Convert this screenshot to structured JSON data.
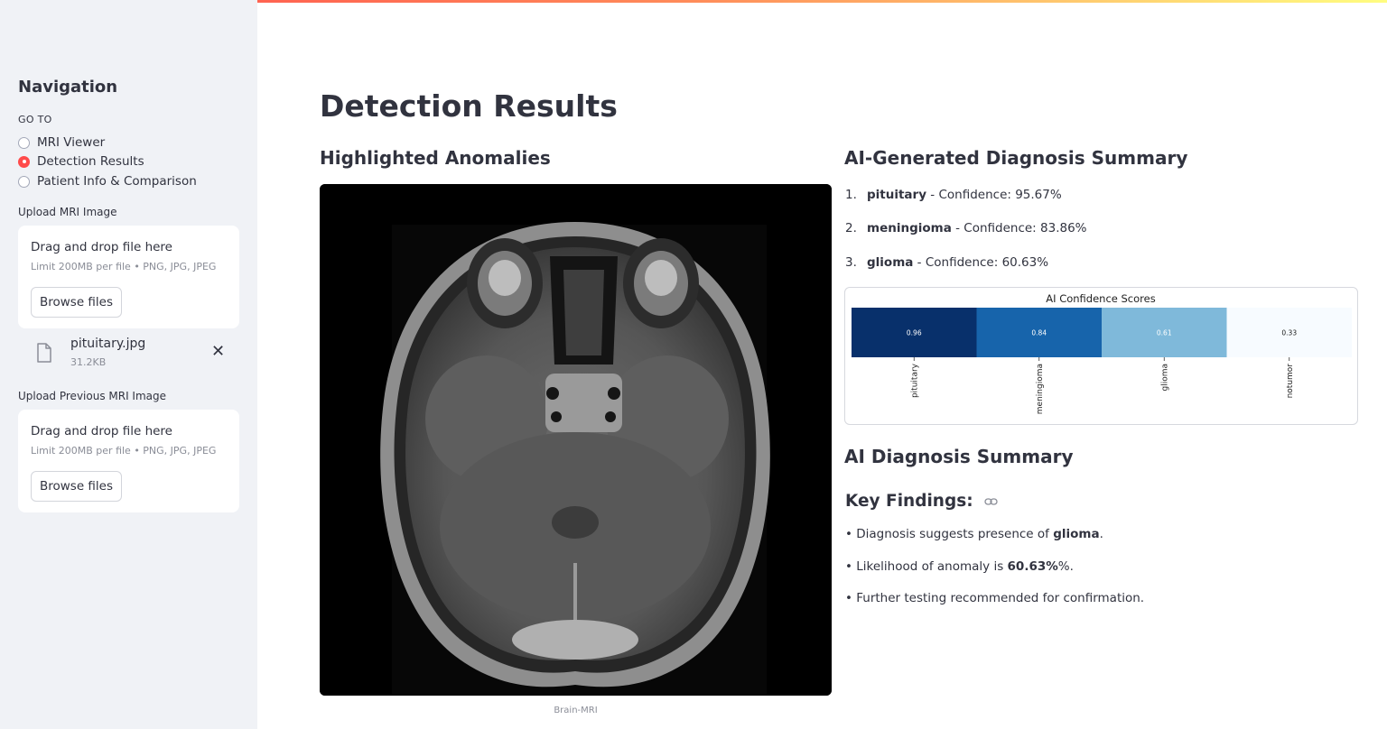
{
  "sidebar": {
    "title": "Navigation",
    "goto_label": "GO TO",
    "options": [
      {
        "label": "MRI Viewer",
        "selected": false
      },
      {
        "label": "Detection Results",
        "selected": true
      },
      {
        "label": "Patient Info & Comparison",
        "selected": false
      }
    ],
    "upload_label": "Upload MRI Image",
    "dropzone_title": "Drag and drop file here",
    "dropzone_limit": "Limit 200MB per file • PNG, JPG, JPEG",
    "browse_label": "Browse files",
    "uploaded_file": {
      "name": "pituitary.jpg",
      "size": "31.2KB",
      "icon": "file-icon"
    },
    "upload_prev_label": "Upload Previous MRI Image",
    "prev_dropzone_title": "Drag and drop file here",
    "prev_dropzone_limit": "Limit 200MB per file • PNG, JPG, JPEG",
    "prev_browse_label": "Browse files"
  },
  "main": {
    "title": "Detection Results",
    "anomalies_heading": "Highlighted Anomalies",
    "image_caption": "Brain-MRI",
    "summary_heading": "AI-Generated Diagnosis Summary",
    "predictions": [
      {
        "num": "1.",
        "label": "pituitary",
        "text": " - Confidence: 95.67%"
      },
      {
        "num": "2.",
        "label": "meningioma",
        "text": " - Confidence: 83.86%"
      },
      {
        "num": "3.",
        "label": "glioma",
        "text": " - Confidence: 60.63%"
      }
    ],
    "diag_heading": "AI Diagnosis Summary",
    "key_findings": "Key Findings:",
    "findings": [
      {
        "pre": "• Diagnosis suggests presence of ",
        "bold": "glioma",
        "post": "."
      },
      {
        "pre": "• Likelihood of anomaly is ",
        "bold": "60.63%",
        "post": "%."
      },
      {
        "pre": "• Further testing recommended for confirmation.",
        "bold": "",
        "post": ""
      }
    ]
  },
  "colors": {
    "accent": "#ff4b4b",
    "sidebar_bg": "#f0f2f6",
    "text": "#31333f"
  },
  "chart_data": {
    "type": "heatmap",
    "title": "AI Confidence Scores",
    "categories": [
      "pituitary",
      "meningioma",
      "glioma",
      "notumor"
    ],
    "values": [
      0.96,
      0.84,
      0.61,
      0.33
    ],
    "value_labels": [
      "0.96",
      "0.84",
      "0.61",
      "0.33"
    ],
    "colormap": "Blues",
    "colors": [
      "#08306b",
      "#1764ab",
      "#7fb9da",
      "#f7fbff"
    ]
  }
}
